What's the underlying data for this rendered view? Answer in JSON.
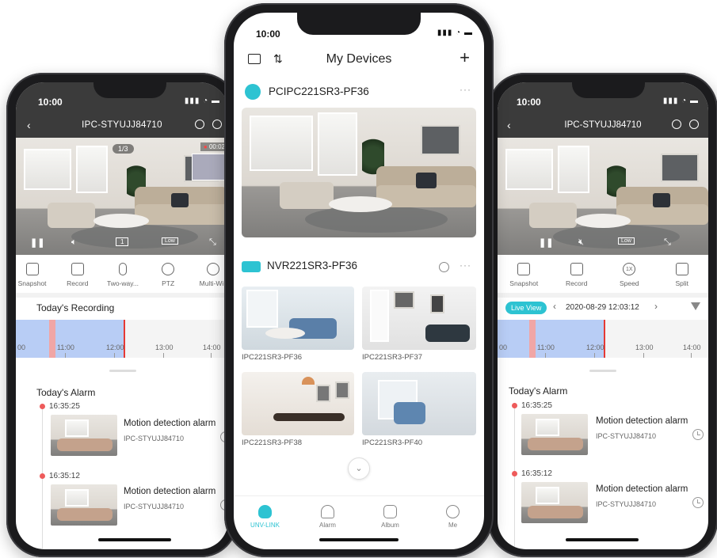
{
  "status": {
    "time": "10:00",
    "icons": "all-signal-wifi-battery"
  },
  "left_phone": {
    "device_title": "IPC-STYUJJ84710",
    "page_indicator": "1/3",
    "rec_badge": "00:02",
    "quality": "Low",
    "channel": "1",
    "tools": [
      "Snapshot",
      "Record",
      "Two-way...",
      "PTZ",
      "Multi-Win"
    ],
    "recording_title": "Today's Recording",
    "ticks": [
      "00",
      "11:00",
      "12:00",
      "13:00",
      "14:00"
    ],
    "alarm_title": "Today's Alarm",
    "alarms": [
      {
        "time": "16:35:25",
        "title": "Motion detection alarm",
        "device": "IPC-STYUJJ84710"
      },
      {
        "time": "16:35:12",
        "title": "Motion detection alarm",
        "device": "IPC-STYUJJ84710"
      }
    ]
  },
  "center_phone": {
    "header_title": "My Devices",
    "device1_name": "PCIPC221SR3-PF36",
    "device2_name": "NVR221SR3-PF36",
    "cameras": [
      "IPC221SR3-PF36",
      "IPC221SR3-PF37",
      "IPC221SR3-PF38",
      "IPC221SR3-PF40"
    ],
    "tabs": [
      "UNV-LINK",
      "Alarm",
      "Album",
      "Me"
    ],
    "accent": "#2dc3d2"
  },
  "right_phone": {
    "device_title": "IPC-STYUJJ84710",
    "quality": "Low",
    "tools": [
      "Snapshot",
      "Record",
      "Speed",
      "Split"
    ],
    "speed_badge": "1X",
    "live_view_label": "Live View",
    "datetime": "2020-08-29 12:03:12",
    "ticks": [
      "00",
      "11:00",
      "12:00",
      "13:00",
      "14:00"
    ],
    "alarm_title": "Today's Alarm",
    "alarms": [
      {
        "time": "16:35:25",
        "title": "Motion detection alarm",
        "device": "IPC-STYUJJ84710"
      },
      {
        "time": "16:35:12",
        "title": "Motion detection alarm",
        "device": "IPC-STYUJJ84710"
      }
    ]
  }
}
